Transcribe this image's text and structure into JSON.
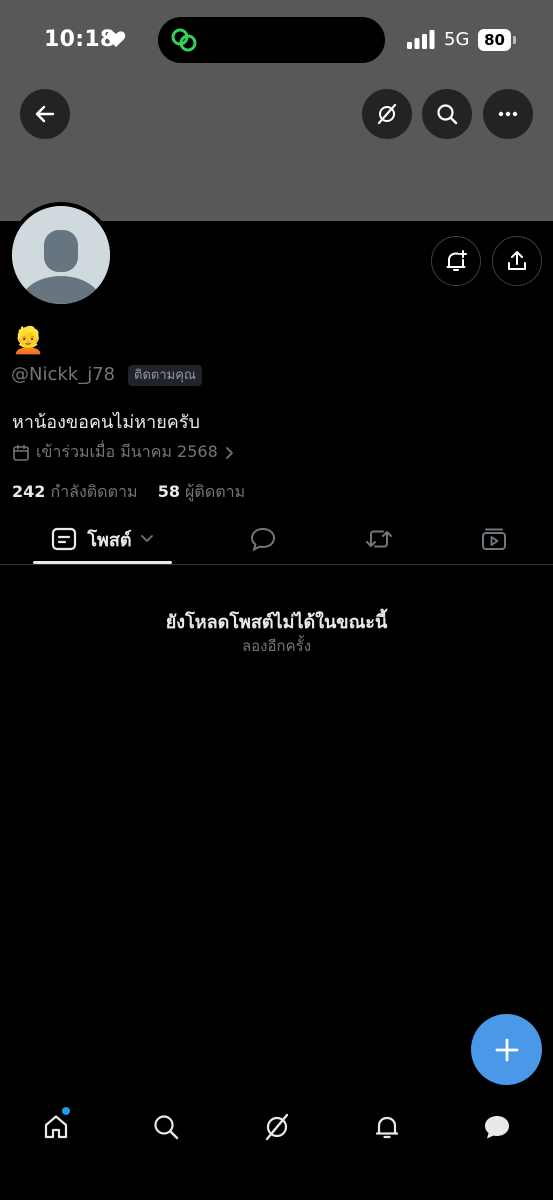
{
  "status_bar": {
    "time": "10:18",
    "network": "5G",
    "battery": "80"
  },
  "profile": {
    "display_name": "👱",
    "handle": "@Nickk_j78",
    "follows_you": "ติดตามคุณ",
    "bio": "หาน้องขอคนไม่หายครับ",
    "joined": "เข้าร่วมเมื่อ มีนาคม 2568",
    "following_count": "242",
    "following_label": "กำลังติดตาม",
    "followers_count": "58",
    "followers_label": "ผู้ติดตาม"
  },
  "tabs": {
    "posts_label": "โพสต์"
  },
  "empty_state": {
    "title": "ยังโหลดโพสต์ไม่ได้ในขณะนี้",
    "subtitle": "ลองอีกครั้ง"
  },
  "colors": {
    "banner": "#585858",
    "accent": "#1d9bf0",
    "fab": "#4a99e9"
  }
}
